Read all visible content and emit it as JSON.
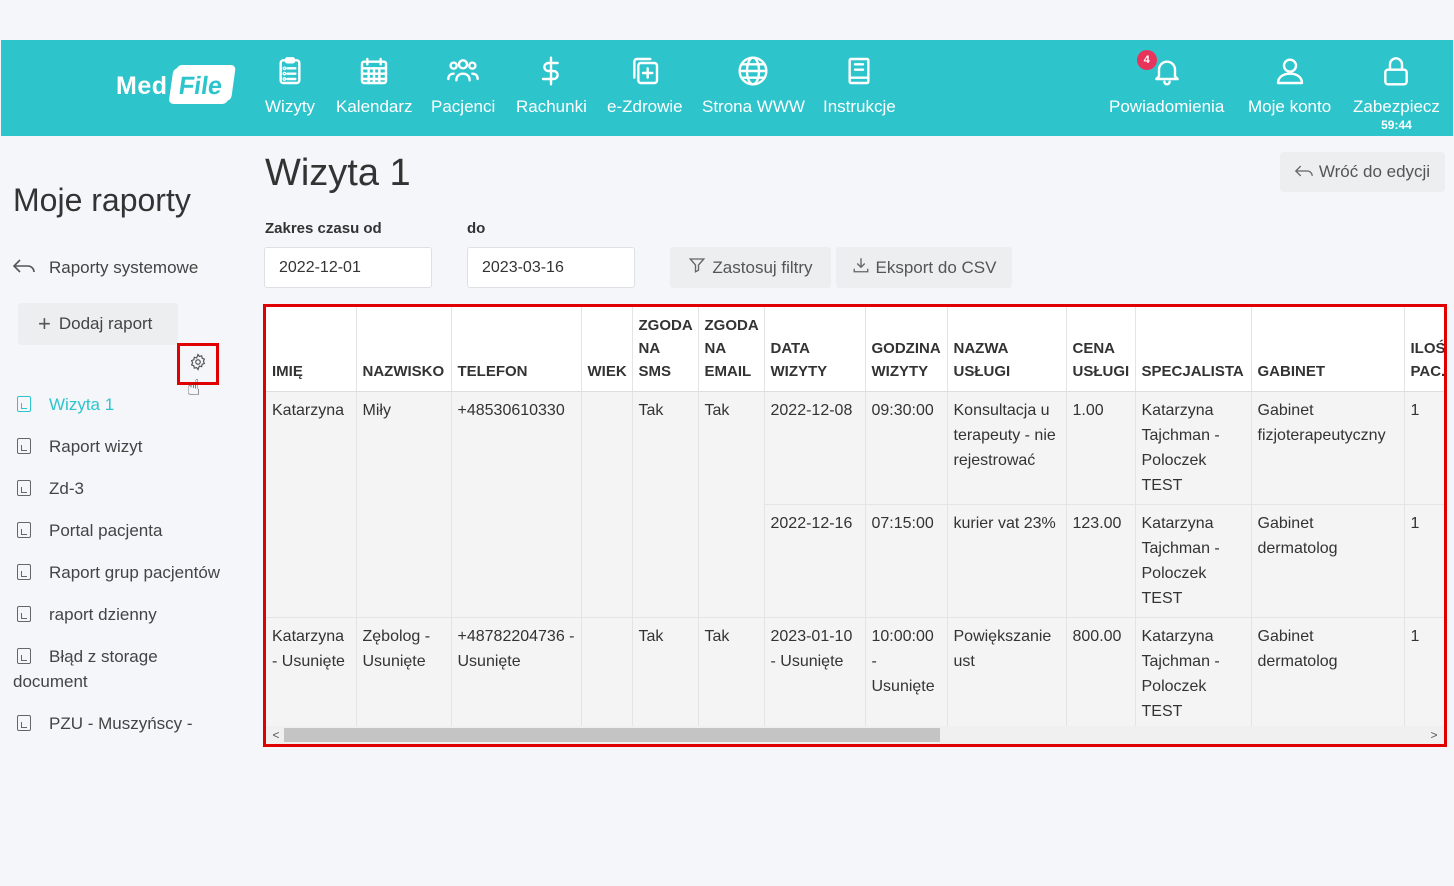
{
  "nav": {
    "logo_med": "Med",
    "logo_file": "File",
    "items": [
      {
        "label": "Wizyty",
        "icon": "clipboard-list-icon"
      },
      {
        "label": "Kalendarz",
        "icon": "calendar-icon"
      },
      {
        "label": "Pacjenci",
        "icon": "users-icon"
      },
      {
        "label": "Rachunki",
        "icon": "dollar-icon"
      },
      {
        "label": "e-Zdrowie",
        "icon": "medical-copy-icon"
      },
      {
        "label": "Strona WWW",
        "icon": "globe-icon"
      },
      {
        "label": "Instrukcje",
        "icon": "book-icon"
      }
    ],
    "notifications": {
      "label": "Powiadomienia",
      "count": "4",
      "icon": "bell-icon"
    },
    "account": {
      "label": "Moje konto",
      "icon": "user-icon"
    },
    "lock": {
      "label": "Zabezpiecz",
      "timer": "59:44",
      "icon": "lock-icon"
    }
  },
  "sidebar": {
    "title": "Moje raporty",
    "back_label": "Raporty systemowe",
    "add_label": "Dodaj raport",
    "reports": [
      {
        "label": "Wizyta 1",
        "active": true
      },
      {
        "label": "Raport wizyt"
      },
      {
        "label": "Zd-3"
      },
      {
        "label": "Portal pacjenta"
      },
      {
        "label": "Raport grup pacjentów"
      },
      {
        "label": "raport dzienny"
      },
      {
        "label": "Błąd z storage document"
      },
      {
        "label": "PZU - Muszyńscy -"
      }
    ]
  },
  "main": {
    "title": "Wizyta 1",
    "back_edit_label": "Wróć do edycji",
    "from_label": "Zakres czasu od",
    "to_label": "do",
    "from_value": "2022-12-01",
    "to_value": "2023-03-16",
    "apply_label": "Zastosuj filtry",
    "export_label": "Eksport do CSV"
  },
  "table": {
    "headers": [
      "IMIĘ",
      "NAZWISKO",
      "TELEFON",
      "WIEK",
      "ZGODA NA SMS",
      "ZGODA NA EMAIL",
      "DATA WIZYTY",
      "GODZINA WIZYTY",
      "NAZWA USŁUGI",
      "CENA USŁUGI",
      "SPECJALISTA",
      "GABINET",
      "ILOŚ PAC."
    ],
    "patients": [
      {
        "imie": "Katarzyna",
        "nazwisko": "Miły",
        "telefon": "+48530610330",
        "wiek": "",
        "sms": "Tak",
        "email": "Tak",
        "visits": [
          {
            "data": "2022-12-08",
            "godzina": "09:30:00",
            "usluga": "Konsultacja u terapeuty - nie rejestrować",
            "cena": "1.00",
            "specjalista": "Katarzyna Tajchman - Poloczek TEST",
            "gabinet": "Gabinet fizjoterapeutyczny",
            "ilosc": "1"
          },
          {
            "data": "2022-12-16",
            "godzina": "07:15:00",
            "usluga": "kurier vat 23%",
            "cena": "123.00",
            "specjalista": "Katarzyna Tajchman - Poloczek TEST",
            "gabinet": "Gabinet dermatolog",
            "ilosc": "1"
          }
        ]
      },
      {
        "imie": "Katarzyna - Usunięte",
        "nazwisko": "Zębolog - Usunięte",
        "telefon": "+48782204736 - Usunięte",
        "wiek": "",
        "sms": "Tak",
        "email": "Tak",
        "visits": [
          {
            "data": "2023-01-10 - Usunięte",
            "godzina": "10:00:00 - Usunięte",
            "usluga": "Powiększanie ust",
            "cena": "800.00",
            "specjalista": "Katarzyna Tajchman - Poloczek TEST",
            "gabinet": "Gabinet dermatolog",
            "ilosc": "1"
          }
        ]
      }
    ]
  }
}
